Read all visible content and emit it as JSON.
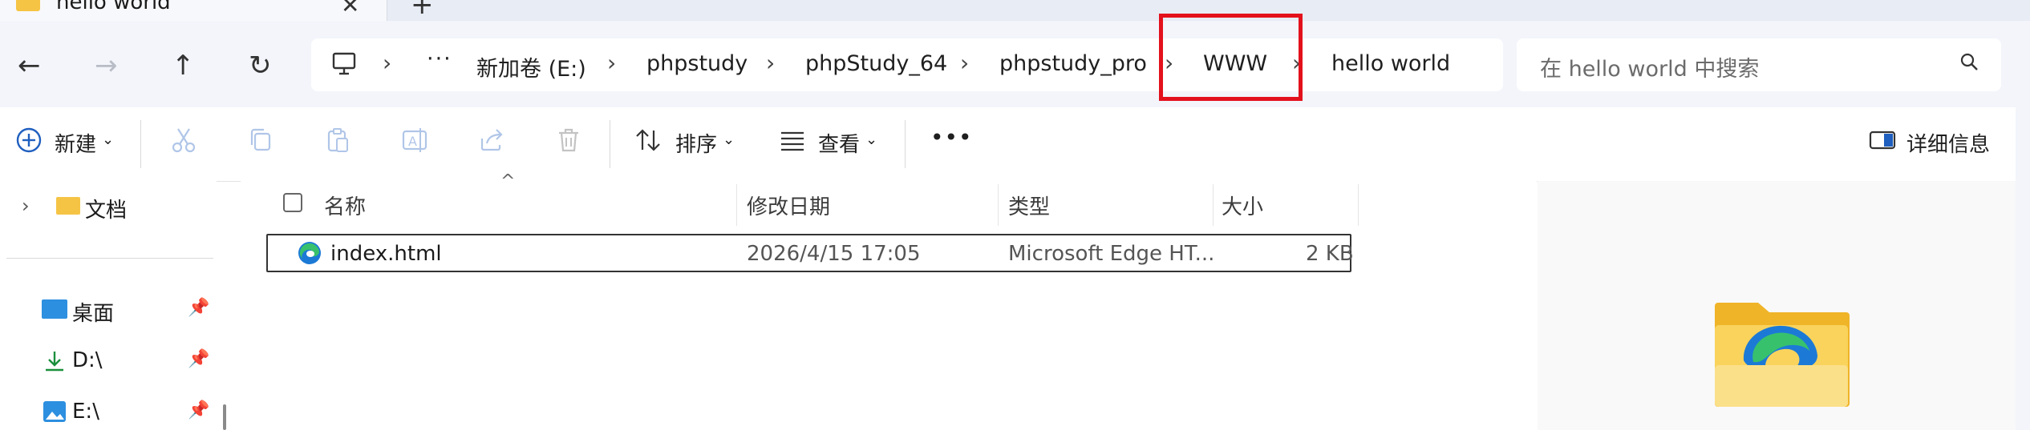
{
  "window": {
    "tab_title": "hello world",
    "tab_close": "✕",
    "tab_new": "+"
  },
  "nav": {
    "back": "←",
    "forward": "→",
    "up": "↑",
    "refresh": "↻",
    "more": "···"
  },
  "breadcrumb": [
    "新加卷 (E:)",
    "phpstudy",
    "phpStudy_64",
    "phpstudy_pro",
    "WWW",
    "hello world"
  ],
  "search": {
    "placeholder": "在 hello world 中搜索"
  },
  "toolbar": {
    "new_label": "新建",
    "sort_label": "排序",
    "view_label": "查看",
    "more_label": "•••",
    "details_label": "详细信息"
  },
  "sidebar": {
    "documents": "文档",
    "quick": [
      {
        "label": "桌面"
      },
      {
        "label": "D:\\"
      },
      {
        "label": "E:\\"
      }
    ]
  },
  "columns": {
    "name": "名称",
    "modified": "修改日期",
    "type": "类型",
    "size": "大小"
  },
  "files": [
    {
      "name": "index.html",
      "modified": "2026/4/15 17:05",
      "type": "Microsoft Edge HT...",
      "size": "2 KB"
    }
  ],
  "colors": {
    "highlight": "#e3111c",
    "folder": "#f6c445",
    "accent": "#0067c0"
  }
}
